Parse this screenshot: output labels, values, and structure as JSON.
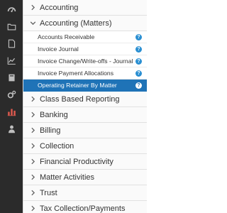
{
  "rail": {
    "icons": [
      {
        "name": "dashboard-icon"
      },
      {
        "name": "folder-icon"
      },
      {
        "name": "document-icon"
      },
      {
        "name": "line-chart-icon"
      },
      {
        "name": "book-icon"
      },
      {
        "name": "gears-icon"
      },
      {
        "name": "bar-chart-icon",
        "active": true
      },
      {
        "name": "user-icon"
      }
    ],
    "colors": {
      "icon": "#bfbfbf",
      "active": "#e05a4f"
    }
  },
  "menu": {
    "categories": [
      {
        "label": "Accounting",
        "expanded": false
      },
      {
        "label": "Accounting (Matters)",
        "expanded": true
      },
      {
        "label": "Class Based Reporting",
        "expanded": false
      },
      {
        "label": "Banking",
        "expanded": false
      },
      {
        "label": "Billing",
        "expanded": false
      },
      {
        "label": "Collection",
        "expanded": false
      },
      {
        "label": "Financial Productivity",
        "expanded": false
      },
      {
        "label": "Matter Activities",
        "expanded": false
      },
      {
        "label": "Trust",
        "expanded": false
      },
      {
        "label": "Tax Collection/Payments",
        "expanded": false
      }
    ],
    "expanded_items": [
      {
        "label": "Accounts Receivable",
        "selected": false
      },
      {
        "label": "Invoice Journal",
        "selected": false
      },
      {
        "label": "Invoice Change/Write-offs - Journal",
        "selected": false
      },
      {
        "label": "Invoice Payment Allocations",
        "selected": false
      },
      {
        "label": "Operating Retainer By Matter",
        "selected": true
      }
    ],
    "help_glyph": "?",
    "colors": {
      "selected_bg": "#1f73b7",
      "help": "#2a8fd2"
    }
  }
}
